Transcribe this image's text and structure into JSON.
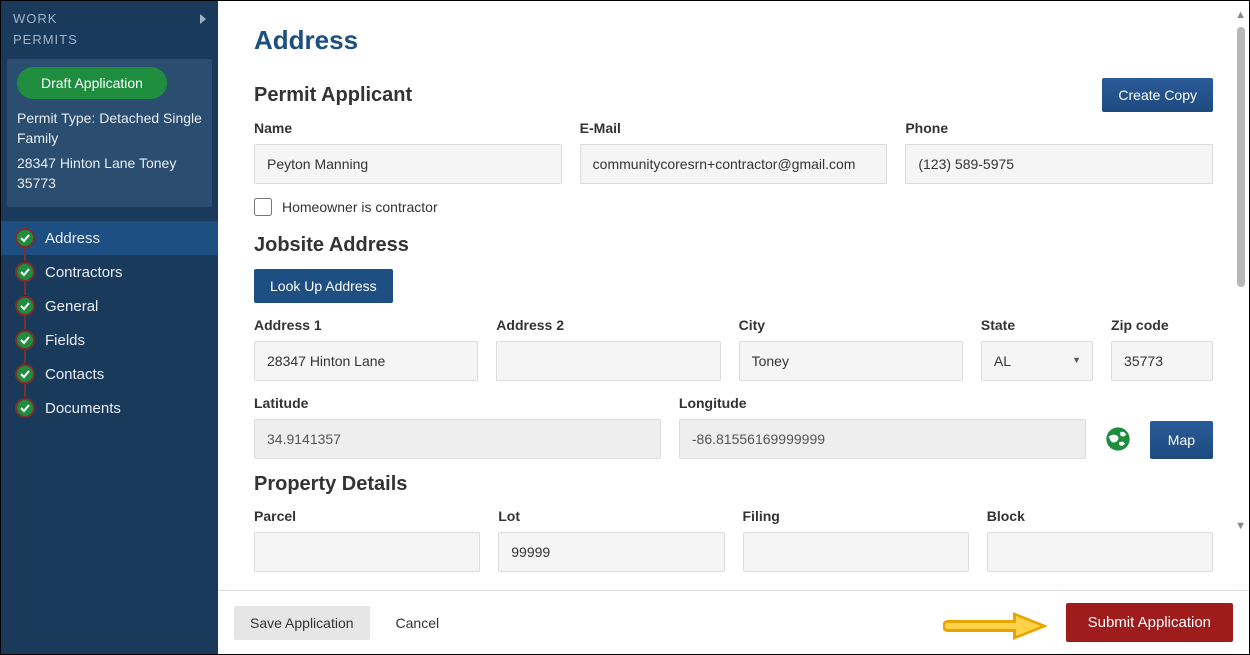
{
  "sidebar": {
    "header1": "WORK",
    "header2": "PERMITS",
    "draft_badge": "Draft Application",
    "permit_type": "Permit Type: Detached Single Family",
    "permit_address": "28347 Hinton Lane Toney 35773",
    "steps": [
      {
        "label": "Address"
      },
      {
        "label": "Contractors"
      },
      {
        "label": "General"
      },
      {
        "label": "Fields"
      },
      {
        "label": "Contacts"
      },
      {
        "label": "Documents"
      }
    ]
  },
  "page": {
    "title": "Address",
    "create_copy": "Create Copy"
  },
  "applicant": {
    "section_title": "Permit Applicant",
    "name_label": "Name",
    "name_value": "Peyton Manning",
    "email_label": "E-Mail",
    "email_value": "communitycoresrn+contractor@gmail.com",
    "phone_label": "Phone",
    "phone_value": "(123) 589-5975",
    "homeowner_label": "Homeowner is contractor"
  },
  "jobsite": {
    "section_title": "Jobsite Address",
    "lookup_btn": "Look Up Address",
    "addr1_label": "Address 1",
    "addr1_value": "28347 Hinton Lane",
    "addr2_label": "Address 2",
    "addr2_value": "",
    "city_label": "City",
    "city_value": "Toney",
    "state_label": "State",
    "state_value": "AL",
    "zip_label": "Zip code",
    "zip_value": "35773",
    "lat_label": "Latitude",
    "lat_value": "34.9141357",
    "lon_label": "Longitude",
    "lon_value": "-86.81556169999999",
    "map_btn": "Map"
  },
  "property": {
    "section_title": "Property Details",
    "parcel_label": "Parcel",
    "parcel_value": "",
    "lot_label": "Lot",
    "lot_value": "99999",
    "filing_label": "Filing",
    "filing_value": "",
    "block_label": "Block",
    "block_value": ""
  },
  "footer": {
    "save": "Save Application",
    "cancel": "Cancel",
    "submit": "Submit Application"
  }
}
